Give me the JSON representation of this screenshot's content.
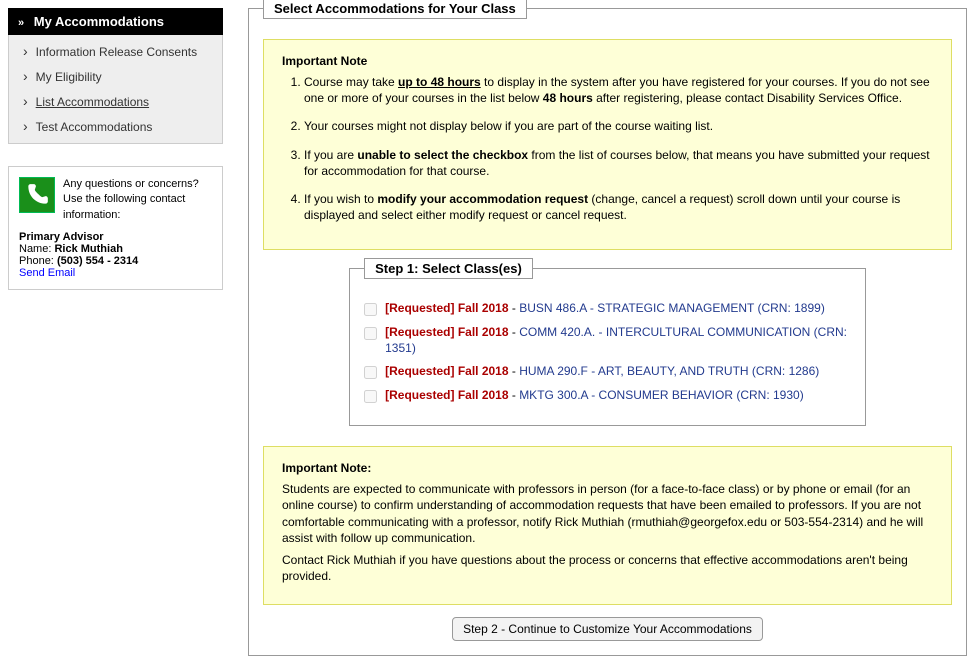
{
  "sidebar": {
    "header": "My Accommodations",
    "items": [
      {
        "label": "Information Release Consents",
        "active": false
      },
      {
        "label": "My Eligibility",
        "active": false
      },
      {
        "label": "List Accommodations",
        "active": true
      },
      {
        "label": "Test Accommodations",
        "active": false
      }
    ],
    "contact": {
      "question": "Any questions or concerns? Use the following contact information:",
      "advisor_label": "Primary Advisor",
      "name_label": "Name:",
      "name": "Rick Muthiah",
      "phone_label": "Phone:",
      "phone": "(503) 554 - 2314",
      "email_link": "Send Email"
    }
  },
  "main": {
    "outer_legend": "Select Accommodations for Your Class",
    "note1": {
      "header": "Important Note",
      "li1_a": "Course may take ",
      "li1_b": "up to 48 hours",
      "li1_c": " to display in the system after you have registered for your courses. If you do not see one or more of your courses in the list below ",
      "li1_d": "48 hours",
      "li1_e": " after registering, please contact Disability Services Office.",
      "li2": "Your courses might not display below if you are part of the course waiting list.",
      "li3_a": "If you are ",
      "li3_b": "unable to select the checkbox",
      "li3_c": " from the list of courses below, that means you have submitted your request for accommodation for that course.",
      "li4_a": "If you wish to ",
      "li4_b": "modify your accommodation request",
      "li4_c": " (change, cancel a request) scroll down until your course is displayed and select either modify request or cancel request."
    },
    "step1": {
      "legend": "Step 1: Select Class(es)",
      "requested_tag": "[Requested]",
      "term": "Fall 2018",
      "sep": " - ",
      "classes": [
        {
          "course": "BUSN 486.A - STRATEGIC MANAGEMENT (CRN: 1899)"
        },
        {
          "course": "COMM 420.A. - INTERCULTURAL COMMUNICATION (CRN: 1351)"
        },
        {
          "course": "HUMA 290.F - ART, BEAUTY, AND TRUTH (CRN: 1286)"
        },
        {
          "course": "MKTG 300.A - CONSUMER BEHAVIOR (CRN: 1930)"
        }
      ]
    },
    "note2": {
      "header": "Important Note:",
      "p1": "Students are expected to communicate with professors in person (for a face-to-face class) or by phone or email (for an online course) to confirm understanding of accommodation requests that have been emailed to professors. If you are not comfortable communicating with a professor, notify Rick Muthiah (rmuthiah@georgefox.edu or 503-554-2314) and he will assist with follow up communication.",
      "p2": "Contact Rick Muthiah if you have questions about the process or concerns that effective accommodations aren't being provided."
    },
    "step2_button": "Step 2 - Continue to Customize Your Accommodations"
  }
}
